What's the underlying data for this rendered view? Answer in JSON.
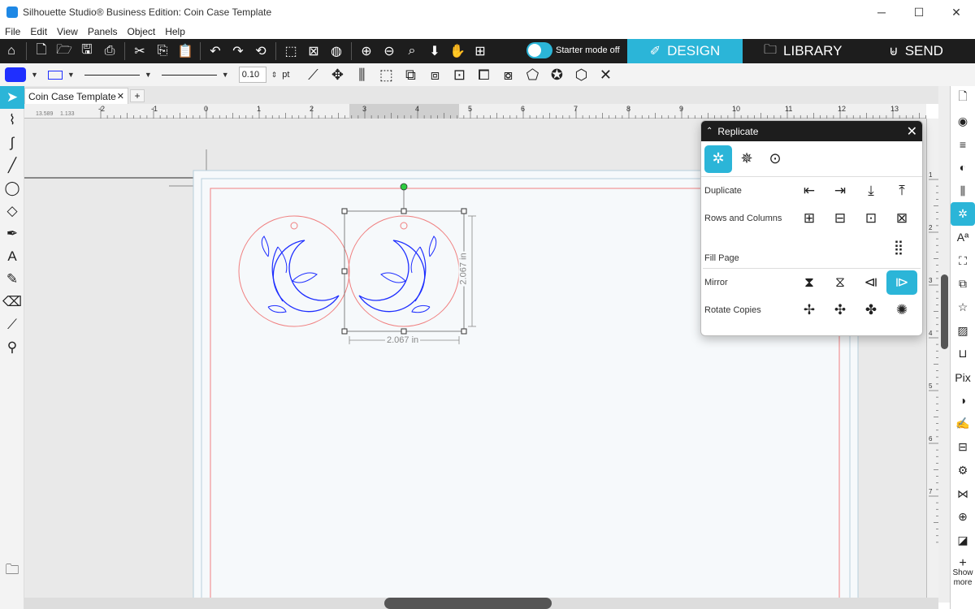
{
  "window": {
    "title": "Silhouette Studio® Business Edition: Coin Case Template",
    "minimize": "─",
    "maximize": "☐",
    "close": "✕"
  },
  "menu": [
    "File",
    "Edit",
    "View",
    "Panels",
    "Object",
    "Help"
  ],
  "toolbar": {
    "starter_mode": "Starter mode off",
    "tabs": {
      "design": "DESIGN",
      "library": "LIBRARY",
      "send": "SEND"
    }
  },
  "properties": {
    "line_width": "0.10",
    "line_unit": "pt"
  },
  "document": {
    "tab_name": "Coin Case Template",
    "add_tab": "+"
  },
  "ruler": {
    "cursor_x": "13.589",
    "cursor_y": "1.133",
    "top_ticks": [
      "-2",
      "-1",
      "0",
      "1",
      "2",
      "3",
      "4",
      "5",
      "6",
      "7",
      "8",
      "9",
      "10",
      "11",
      "12",
      "13"
    ],
    "side_ticks": [
      "1",
      "2",
      "3",
      "4",
      "5",
      "6",
      "7"
    ]
  },
  "selection": {
    "width_label": "2.067 in",
    "height_label": "2.067 in"
  },
  "replicate_panel": {
    "title": "Replicate",
    "tab_icons": [
      "replicate-icon",
      "replicate-radial-icon",
      "replicate-circle-icon"
    ],
    "rows": {
      "duplicate": "Duplicate",
      "rows_columns": "Rows and Columns",
      "fill_page": "Fill Page",
      "mirror": "Mirror",
      "rotate_copies": "Rotate Copies"
    }
  },
  "right_panel": {
    "show_more": "Show more"
  },
  "colors": {
    "accent": "#2bb5d8",
    "dark_bar": "#1d1d1d",
    "fill_color": "#1f2fff",
    "cut_line": "#f08080"
  }
}
